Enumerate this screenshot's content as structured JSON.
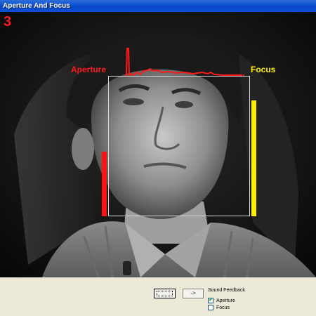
{
  "window": {
    "title": "Aperture And Focus"
  },
  "overlay": {
    "frame_number": "3",
    "aperture_label": "Aperture",
    "focus_label": "Focus",
    "aperture_level": 0.73,
    "focus_level": 1.0,
    "colors": {
      "aperture": "#ff1212",
      "focus": "#ffee00",
      "roi_box": "#d8d8d8"
    }
  },
  "controls": {
    "primary_button_label": "",
    "next_button_label": "->",
    "sound_feedback_label": "Sound Feedback",
    "options": [
      {
        "label": "Aperture",
        "checked": true
      },
      {
        "label": "Focus",
        "checked": false
      }
    ]
  }
}
